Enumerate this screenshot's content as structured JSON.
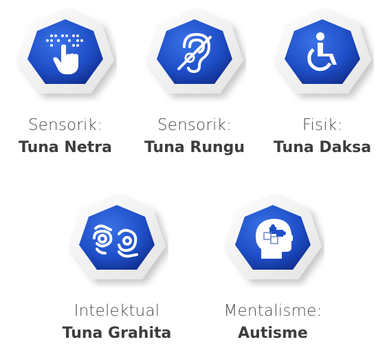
{
  "cards": [
    {
      "category": "Sensorik:",
      "name": "Tuna Netra",
      "icon": "braille-hand-icon"
    },
    {
      "category": "Sensorik:",
      "name": "Tuna Rungu",
      "icon": "hearing-impaired-icon"
    },
    {
      "category": "Fisik:",
      "name": "Tuna Daksa",
      "icon": "wheelchair-icon"
    },
    {
      "category": "Intelektual",
      "name": "Tuna Grahita",
      "icon": "sign-language-icon"
    },
    {
      "category": "Mentalisme:",
      "name": "Autisme",
      "icon": "puzzle-head-icon"
    }
  ],
  "colors": {
    "badge_blue": "#1f4fc8",
    "badge_dark": "#0f2c8a",
    "ring": "#f2f2f2",
    "text": "#3d3d3d"
  }
}
